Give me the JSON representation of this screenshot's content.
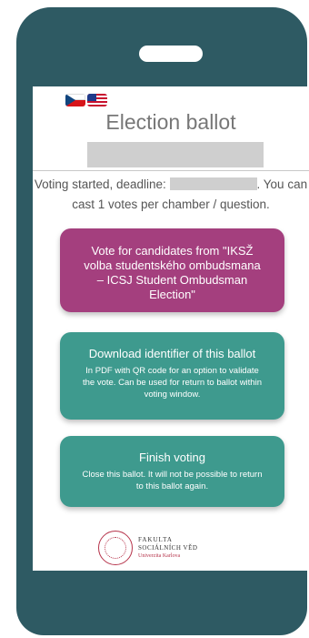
{
  "screen": {
    "title": "Election ballot",
    "info_before": "Voting started, deadline:",
    "info_after": ". You can cast 1 votes per chamber / question."
  },
  "vote_card": {
    "label": "Vote for candidates from \"IKSŽ volba studentského ombudsmana – ICSJ Student Ombudsman Election\"",
    "color": "#a43f7e"
  },
  "download_card": {
    "heading": "Download identifier of this ballot",
    "description": "In PDF with QR code for an option to validate the vote. Can be used for return to ballot within voting window.",
    "color": "#3e9a8e"
  },
  "finish_card": {
    "heading": "Finish voting",
    "description": "Close this ballot. It will not be possible to return to this ballot again.",
    "color": "#3e9a8e"
  },
  "logo": {
    "line1": "FAKULTA",
    "line2": "SOCIÁLNÍCH VĚD",
    "line3": "Univerzita Karlova"
  },
  "flags": [
    "czech-flag-icon",
    "us-flag-icon"
  ]
}
